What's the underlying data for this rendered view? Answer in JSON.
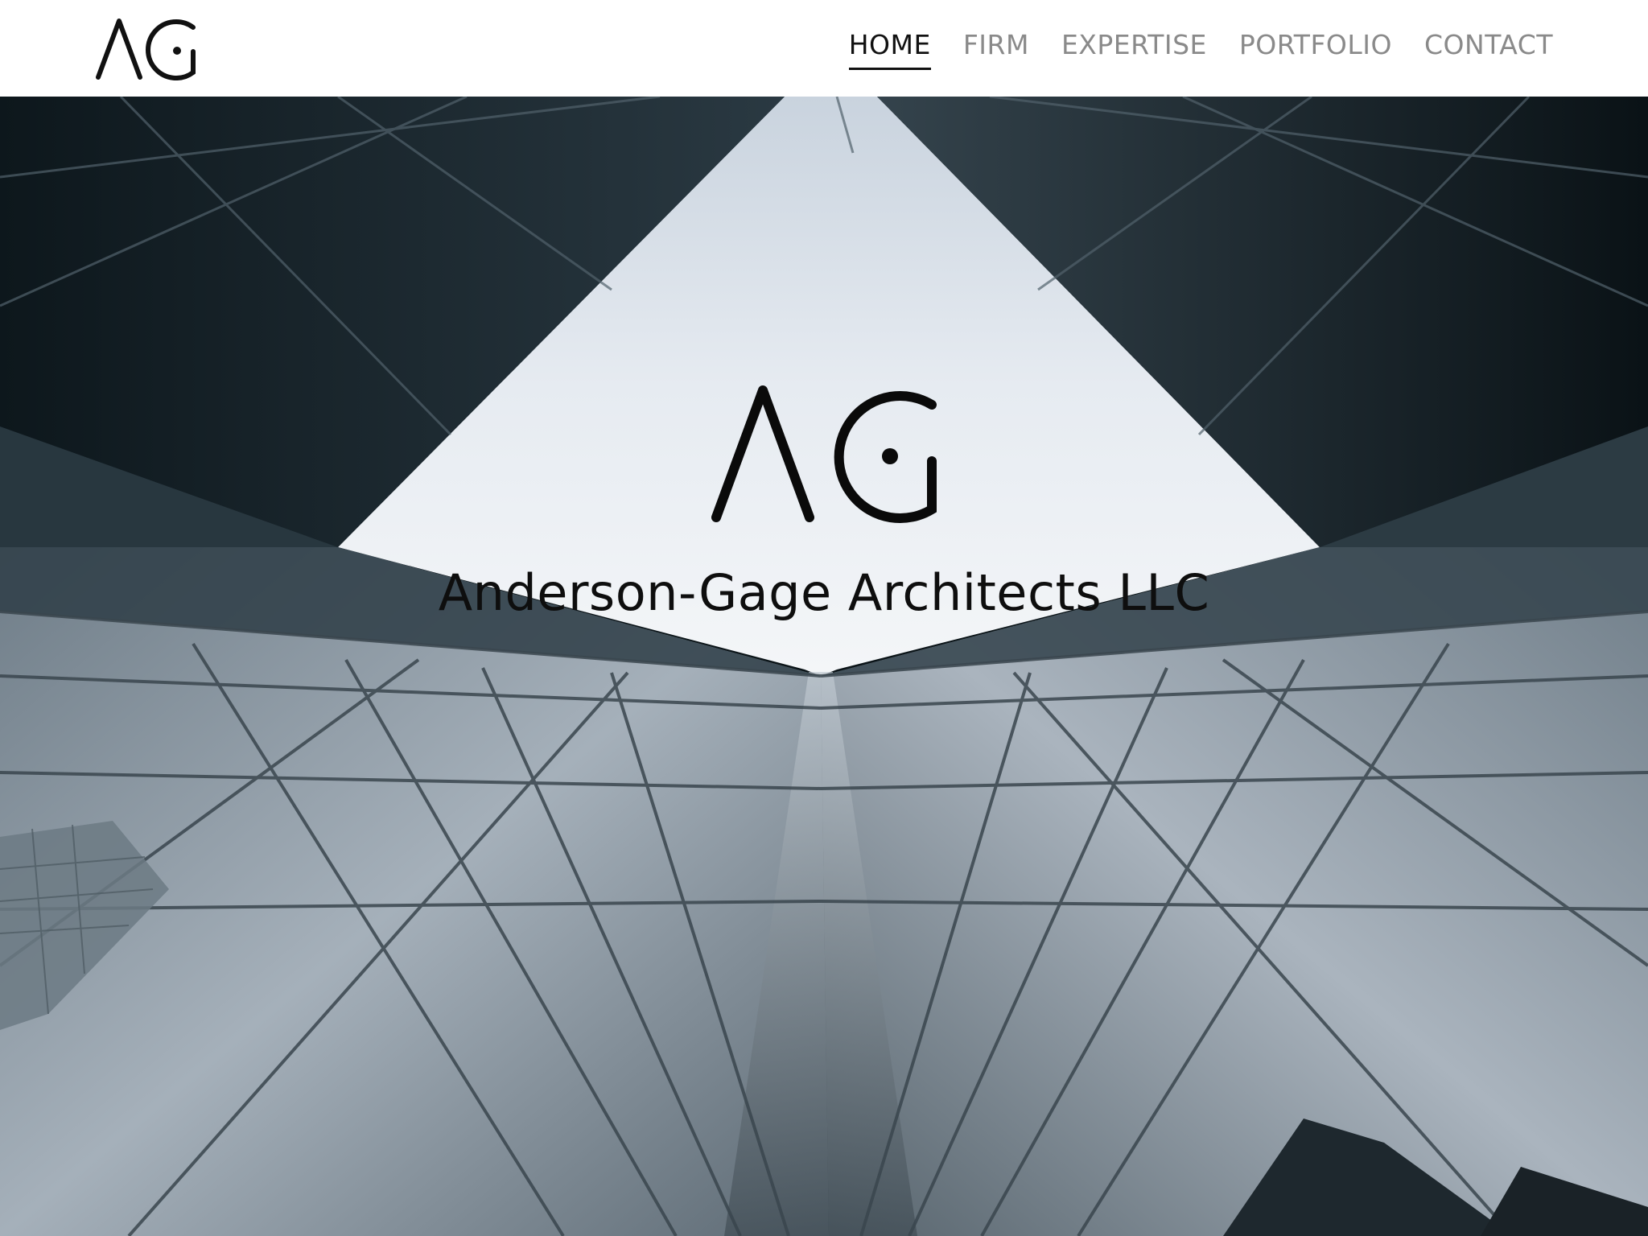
{
  "header": {
    "logo_text": "AG",
    "nav": [
      {
        "label": "HOME",
        "active": true
      },
      {
        "label": "FIRM",
        "active": false
      },
      {
        "label": "EXPERTISE",
        "active": false
      },
      {
        "label": "PORTFOLIO",
        "active": false
      },
      {
        "label": "CONTACT",
        "active": false
      }
    ]
  },
  "hero": {
    "logo_text": "AG",
    "title": "Anderson-Gage Architects LLC"
  },
  "colors": {
    "nav_active": "#111111",
    "nav_inactive": "#8a8a8a",
    "sky": "#dde4ec",
    "glass_dark": "#1c2a32"
  }
}
